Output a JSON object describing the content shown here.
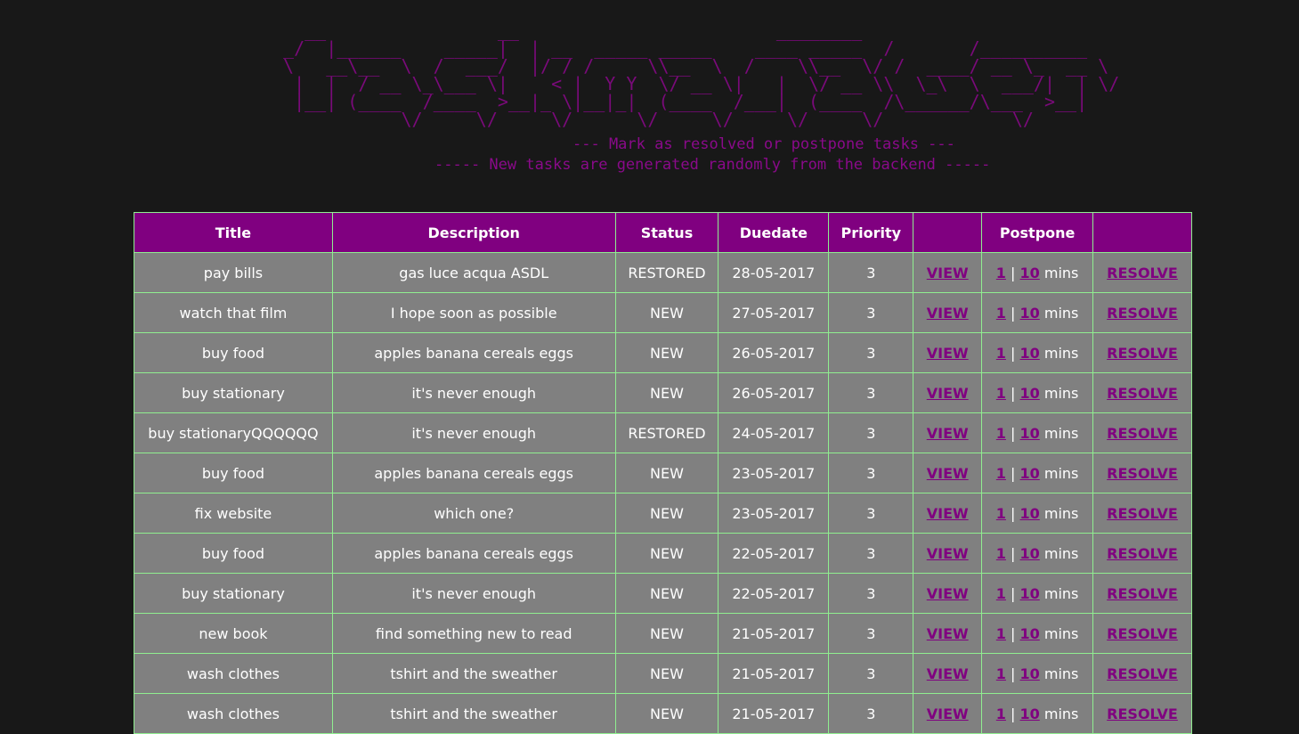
{
  "banner": {
    "ascii_art": "   __                __                        ________\n _/  |______    _____|  | __  _____ _____    ____ _____  /       /__________\n \\   __\\__  \\  /  ___/  |/ / /     \\\\__  \\  /    \\\\__  \\/ /  ____/ __ \\_  __ \\\n  |  |  / __ \\_\\___ \\|    < |  Y Y  \\/ __ \\|   |  \\/ __ \\\\  \\_\\  \\  ___/|  | \\/\n  |__| (____  /____  >__|_ \\|__|_|  (____  /___|  (____  /\\______/\\___  >__|\n            \\/     \\/     \\/      \\/     \\/     \\/     \\/            \\/",
    "tagline_1": "--- Mark as resolved or postpone tasks ---",
    "tagline_2": "----- New tasks are generated randomly from the backend -----"
  },
  "table": {
    "headers": [
      "Title",
      "Description",
      "Status",
      "Duedate",
      "Priority",
      "",
      "Postpone",
      ""
    ],
    "view_label": "VIEW",
    "postpone_1": "1",
    "postpone_sep": "|",
    "postpone_10": "10",
    "postpone_unit": "mins",
    "resolve_label": "RESOLVE",
    "rows": [
      {
        "title": "pay bills",
        "description": "gas luce acqua ASDL",
        "status": "RESTORED",
        "duedate": "28-05-2017",
        "priority": "3"
      },
      {
        "title": "watch that film",
        "description": "I hope soon as possible",
        "status": "NEW",
        "duedate": "27-05-2017",
        "priority": "3"
      },
      {
        "title": "buy food",
        "description": "apples banana cereals eggs",
        "status": "NEW",
        "duedate": "26-05-2017",
        "priority": "3"
      },
      {
        "title": "buy stationary",
        "description": "it's never enough",
        "status": "NEW",
        "duedate": "26-05-2017",
        "priority": "3"
      },
      {
        "title": "buy stationaryQQQQQQ",
        "description": "it's never enough",
        "status": "RESTORED",
        "duedate": "24-05-2017",
        "priority": "3"
      },
      {
        "title": "buy food",
        "description": "apples banana cereals eggs",
        "status": "NEW",
        "duedate": "23-05-2017",
        "priority": "3"
      },
      {
        "title": "fix website",
        "description": "which one?",
        "status": "NEW",
        "duedate": "23-05-2017",
        "priority": "3"
      },
      {
        "title": "buy food",
        "description": "apples banana cereals eggs",
        "status": "NEW",
        "duedate": "22-05-2017",
        "priority": "3"
      },
      {
        "title": "buy stationary",
        "description": "it's never enough",
        "status": "NEW",
        "duedate": "22-05-2017",
        "priority": "3"
      },
      {
        "title": "new book",
        "description": "find something new to read",
        "status": "NEW",
        "duedate": "21-05-2017",
        "priority": "3"
      },
      {
        "title": "wash clothes",
        "description": "tshirt and the sweather",
        "status": "NEW",
        "duedate": "21-05-2017",
        "priority": "3"
      },
      {
        "title": "wash clothes",
        "description": "tshirt and the sweather",
        "status": "NEW",
        "duedate": "21-05-2017",
        "priority": "3"
      }
    ]
  },
  "colors": {
    "page_background": "#181818",
    "accent_purple": "#800080",
    "cell_gray": "#808080",
    "border_green": "#90ee90"
  }
}
